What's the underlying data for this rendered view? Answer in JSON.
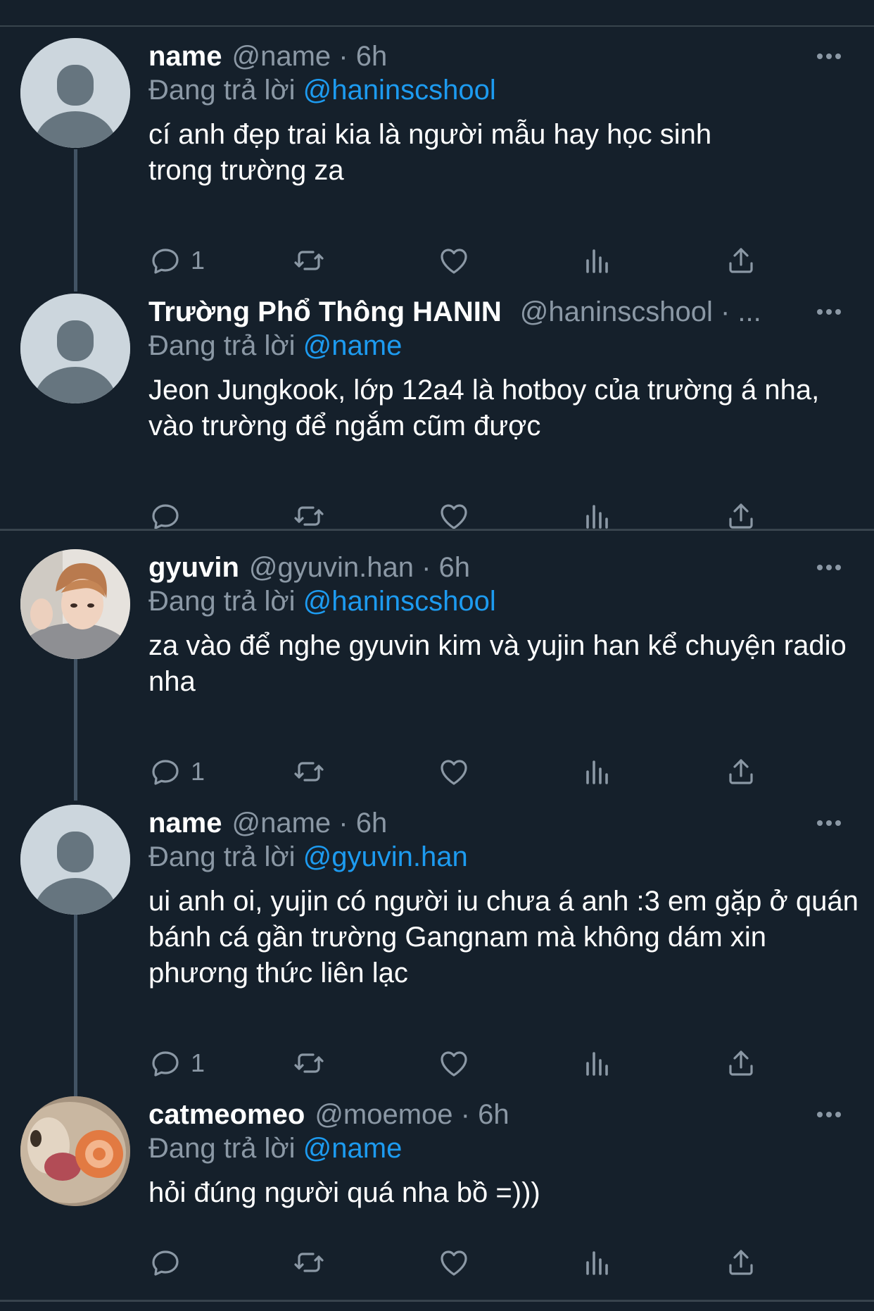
{
  "tweets": [
    {
      "name": "name",
      "meta": "@name · 6h",
      "reply_label": "Đang trả lời",
      "reply_to": "@haninscshool",
      "text": "cí anh đẹp trai kia là người mẫu hay học sinh trong trường za",
      "reply_count": "1",
      "avatar": "default-avatar"
    },
    {
      "name": "Trường Phổ Thông HANIN",
      "meta": "@haninscshool · ...",
      "reply_label": "Đang trả lời",
      "reply_to": "@name",
      "text": "Jeon Jungkook, lớp 12a4 là hotboy của trường á nha, vào trường để ngắm cũm được",
      "reply_count": "",
      "avatar": "default-avatar"
    },
    {
      "name": "gyuvin",
      "meta": "@gyuvin.han · 6h",
      "reply_label": "Đang trả lời",
      "reply_to": "@haninscshool",
      "text": "za vào để nghe gyuvin kim và yujin han kể chuyện radio nha",
      "reply_count": "1",
      "avatar": "photo-avatar-person"
    },
    {
      "name": "name",
      "meta": "@name · 6h",
      "reply_label": "Đang trả lời",
      "reply_to": "@gyuvin.han",
      "text": "ui anh oi, yujin có người iu chưa á anh :3 em gặp ở quán bánh cá gần trường Gangnam mà không dám xin phương thức liên lạc",
      "reply_count": "1",
      "avatar": "default-avatar"
    },
    {
      "name": "catmeomeo",
      "meta": "@moemoe · 6h",
      "reply_label": "Đang trả lời",
      "reply_to": "@name",
      "text": "hỏi đúng người quá nha bồ =)))",
      "reply_count": "",
      "avatar": "photo-avatar-cat"
    }
  ],
  "icons": {
    "reply": "reply-icon",
    "retweet": "retweet-icon",
    "like": "heart-icon",
    "views": "views-icon",
    "share": "share-icon",
    "more": "more-icon"
  },
  "colors": {
    "background": "#15202b",
    "secondary_text": "#8b98a5",
    "link": "#1d9bf0",
    "divider": "#38444d"
  }
}
